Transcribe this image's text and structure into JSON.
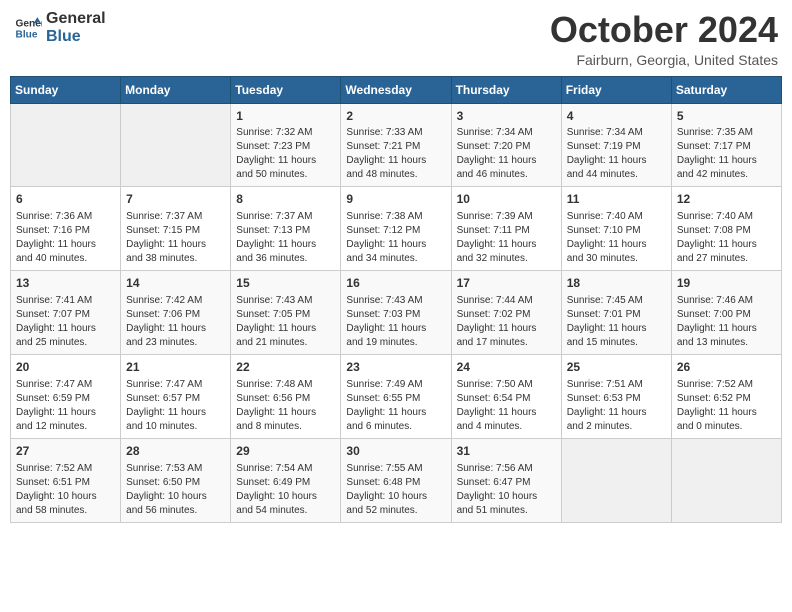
{
  "header": {
    "logo_line1": "General",
    "logo_line2": "Blue",
    "month": "October 2024",
    "location": "Fairburn, Georgia, United States"
  },
  "days_of_week": [
    "Sunday",
    "Monday",
    "Tuesday",
    "Wednesday",
    "Thursday",
    "Friday",
    "Saturday"
  ],
  "weeks": [
    [
      {
        "day": "",
        "info": ""
      },
      {
        "day": "",
        "info": ""
      },
      {
        "day": "1",
        "info": "Sunrise: 7:32 AM\nSunset: 7:23 PM\nDaylight: 11 hours and 50 minutes."
      },
      {
        "day": "2",
        "info": "Sunrise: 7:33 AM\nSunset: 7:21 PM\nDaylight: 11 hours and 48 minutes."
      },
      {
        "day": "3",
        "info": "Sunrise: 7:34 AM\nSunset: 7:20 PM\nDaylight: 11 hours and 46 minutes."
      },
      {
        "day": "4",
        "info": "Sunrise: 7:34 AM\nSunset: 7:19 PM\nDaylight: 11 hours and 44 minutes."
      },
      {
        "day": "5",
        "info": "Sunrise: 7:35 AM\nSunset: 7:17 PM\nDaylight: 11 hours and 42 minutes."
      }
    ],
    [
      {
        "day": "6",
        "info": "Sunrise: 7:36 AM\nSunset: 7:16 PM\nDaylight: 11 hours and 40 minutes."
      },
      {
        "day": "7",
        "info": "Sunrise: 7:37 AM\nSunset: 7:15 PM\nDaylight: 11 hours and 38 minutes."
      },
      {
        "day": "8",
        "info": "Sunrise: 7:37 AM\nSunset: 7:13 PM\nDaylight: 11 hours and 36 minutes."
      },
      {
        "day": "9",
        "info": "Sunrise: 7:38 AM\nSunset: 7:12 PM\nDaylight: 11 hours and 34 minutes."
      },
      {
        "day": "10",
        "info": "Sunrise: 7:39 AM\nSunset: 7:11 PM\nDaylight: 11 hours and 32 minutes."
      },
      {
        "day": "11",
        "info": "Sunrise: 7:40 AM\nSunset: 7:10 PM\nDaylight: 11 hours and 30 minutes."
      },
      {
        "day": "12",
        "info": "Sunrise: 7:40 AM\nSunset: 7:08 PM\nDaylight: 11 hours and 27 minutes."
      }
    ],
    [
      {
        "day": "13",
        "info": "Sunrise: 7:41 AM\nSunset: 7:07 PM\nDaylight: 11 hours and 25 minutes."
      },
      {
        "day": "14",
        "info": "Sunrise: 7:42 AM\nSunset: 7:06 PM\nDaylight: 11 hours and 23 minutes."
      },
      {
        "day": "15",
        "info": "Sunrise: 7:43 AM\nSunset: 7:05 PM\nDaylight: 11 hours and 21 minutes."
      },
      {
        "day": "16",
        "info": "Sunrise: 7:43 AM\nSunset: 7:03 PM\nDaylight: 11 hours and 19 minutes."
      },
      {
        "day": "17",
        "info": "Sunrise: 7:44 AM\nSunset: 7:02 PM\nDaylight: 11 hours and 17 minutes."
      },
      {
        "day": "18",
        "info": "Sunrise: 7:45 AM\nSunset: 7:01 PM\nDaylight: 11 hours and 15 minutes."
      },
      {
        "day": "19",
        "info": "Sunrise: 7:46 AM\nSunset: 7:00 PM\nDaylight: 11 hours and 13 minutes."
      }
    ],
    [
      {
        "day": "20",
        "info": "Sunrise: 7:47 AM\nSunset: 6:59 PM\nDaylight: 11 hours and 12 minutes."
      },
      {
        "day": "21",
        "info": "Sunrise: 7:47 AM\nSunset: 6:57 PM\nDaylight: 11 hours and 10 minutes."
      },
      {
        "day": "22",
        "info": "Sunrise: 7:48 AM\nSunset: 6:56 PM\nDaylight: 11 hours and 8 minutes."
      },
      {
        "day": "23",
        "info": "Sunrise: 7:49 AM\nSunset: 6:55 PM\nDaylight: 11 hours and 6 minutes."
      },
      {
        "day": "24",
        "info": "Sunrise: 7:50 AM\nSunset: 6:54 PM\nDaylight: 11 hours and 4 minutes."
      },
      {
        "day": "25",
        "info": "Sunrise: 7:51 AM\nSunset: 6:53 PM\nDaylight: 11 hours and 2 minutes."
      },
      {
        "day": "26",
        "info": "Sunrise: 7:52 AM\nSunset: 6:52 PM\nDaylight: 11 hours and 0 minutes."
      }
    ],
    [
      {
        "day": "27",
        "info": "Sunrise: 7:52 AM\nSunset: 6:51 PM\nDaylight: 10 hours and 58 minutes."
      },
      {
        "day": "28",
        "info": "Sunrise: 7:53 AM\nSunset: 6:50 PM\nDaylight: 10 hours and 56 minutes."
      },
      {
        "day": "29",
        "info": "Sunrise: 7:54 AM\nSunset: 6:49 PM\nDaylight: 10 hours and 54 minutes."
      },
      {
        "day": "30",
        "info": "Sunrise: 7:55 AM\nSunset: 6:48 PM\nDaylight: 10 hours and 52 minutes."
      },
      {
        "day": "31",
        "info": "Sunrise: 7:56 AM\nSunset: 6:47 PM\nDaylight: 10 hours and 51 minutes."
      },
      {
        "day": "",
        "info": ""
      },
      {
        "day": "",
        "info": ""
      }
    ]
  ]
}
